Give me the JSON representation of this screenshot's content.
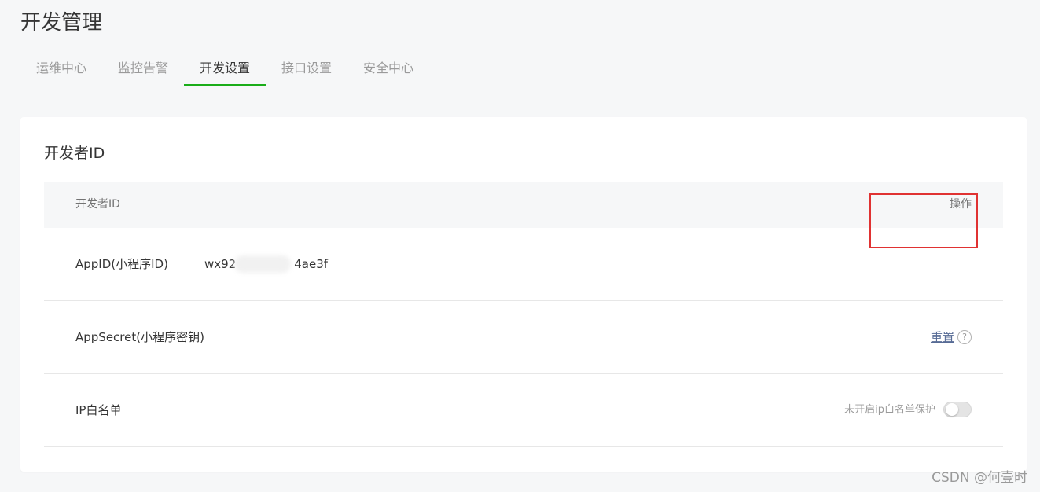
{
  "page": {
    "title": "开发管理"
  },
  "tabs": [
    {
      "label": "运维中心"
    },
    {
      "label": "监控告警"
    },
    {
      "label": "开发设置"
    },
    {
      "label": "接口设置"
    },
    {
      "label": "安全中心"
    }
  ],
  "active_tab": "开发设置",
  "card": {
    "title": "开发者ID",
    "table": {
      "headers": {
        "name": "开发者ID",
        "action": "操作"
      },
      "rows": [
        {
          "label": "AppID(小程序ID)",
          "value_prefix": "wx92",
          "value_suffix": "4ae3f"
        },
        {
          "label": "AppSecret(小程序密钥)",
          "action": "重置"
        },
        {
          "label": "IP白名单",
          "status": "未开启ip白名单保护",
          "toggle_on": false
        }
      ]
    }
  },
  "icons": {
    "help": "question-circle-icon"
  },
  "colors": {
    "accent": "#1aad19",
    "link": "#576b95",
    "highlight": "#e03232"
  },
  "watermark": "CSDN @何壹时"
}
